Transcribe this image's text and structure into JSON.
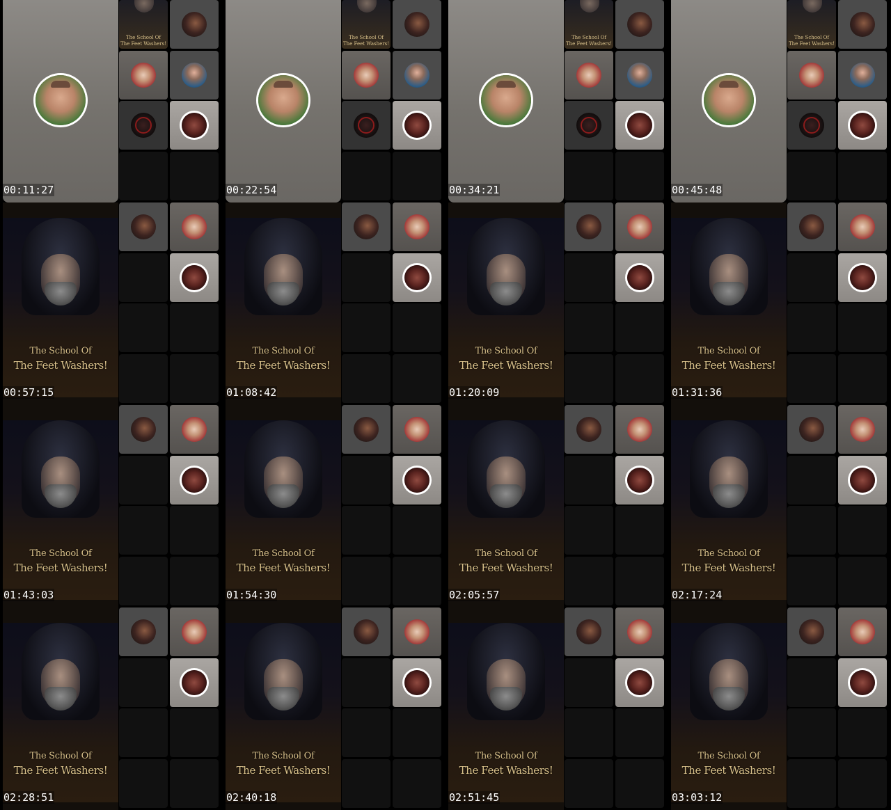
{
  "sheet": {
    "frames": [
      {
        "timestamp": "00:11:27",
        "layout": "gray"
      },
      {
        "timestamp": "00:22:54",
        "layout": "gray"
      },
      {
        "timestamp": "00:34:21",
        "layout": "gray"
      },
      {
        "timestamp": "00:45:48",
        "layout": "gray"
      },
      {
        "timestamp": "00:57:15",
        "layout": "poster"
      },
      {
        "timestamp": "01:08:42",
        "layout": "poster"
      },
      {
        "timestamp": "01:20:09",
        "layout": "poster"
      },
      {
        "timestamp": "01:31:36",
        "layout": "poster"
      },
      {
        "timestamp": "01:43:03",
        "layout": "poster"
      },
      {
        "timestamp": "01:54:30",
        "layout": "poster"
      },
      {
        "timestamp": "02:05:57",
        "layout": "poster"
      },
      {
        "timestamp": "02:17:24",
        "layout": "poster"
      },
      {
        "timestamp": "02:28:51",
        "layout": "poster"
      },
      {
        "timestamp": "02:40:18",
        "layout": "poster"
      },
      {
        "timestamp": "02:51:45",
        "layout": "poster"
      },
      {
        "timestamp": "03:03:12",
        "layout": "poster"
      }
    ]
  },
  "poster": {
    "title_line1": "The School Of",
    "title_line2": "The Feet Washers!"
  },
  "icons": {
    "main_speaker": "avatar-man-icon",
    "woman_dark": "avatar-woman-dark-icon",
    "woman_red": "avatar-woman-red-icon",
    "man_blue": "avatar-man-blue-icon",
    "railway": "railway-logo-icon",
    "seal": "seal-logo-icon"
  },
  "colors": {
    "background": "#000000",
    "timestamp_text": "#ffffff",
    "poster_title": "#d8c08a"
  }
}
